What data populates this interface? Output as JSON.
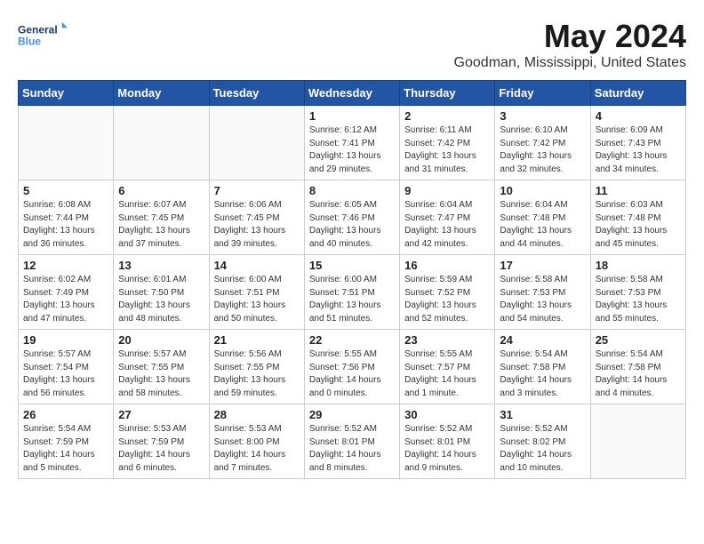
{
  "logo": {
    "line1": "General",
    "line2": "Blue"
  },
  "title": "May 2024",
  "subtitle": "Goodman, Mississippi, United States",
  "headers": [
    "Sunday",
    "Monday",
    "Tuesday",
    "Wednesday",
    "Thursday",
    "Friday",
    "Saturday"
  ],
  "weeks": [
    [
      {
        "day": "",
        "info": ""
      },
      {
        "day": "",
        "info": ""
      },
      {
        "day": "",
        "info": ""
      },
      {
        "day": "1",
        "info": "Sunrise: 6:12 AM\nSunset: 7:41 PM\nDaylight: 13 hours\nand 29 minutes."
      },
      {
        "day": "2",
        "info": "Sunrise: 6:11 AM\nSunset: 7:42 PM\nDaylight: 13 hours\nand 31 minutes."
      },
      {
        "day": "3",
        "info": "Sunrise: 6:10 AM\nSunset: 7:42 PM\nDaylight: 13 hours\nand 32 minutes."
      },
      {
        "day": "4",
        "info": "Sunrise: 6:09 AM\nSunset: 7:43 PM\nDaylight: 13 hours\nand 34 minutes."
      }
    ],
    [
      {
        "day": "5",
        "info": "Sunrise: 6:08 AM\nSunset: 7:44 PM\nDaylight: 13 hours\nand 36 minutes."
      },
      {
        "day": "6",
        "info": "Sunrise: 6:07 AM\nSunset: 7:45 PM\nDaylight: 13 hours\nand 37 minutes."
      },
      {
        "day": "7",
        "info": "Sunrise: 6:06 AM\nSunset: 7:45 PM\nDaylight: 13 hours\nand 39 minutes."
      },
      {
        "day": "8",
        "info": "Sunrise: 6:05 AM\nSunset: 7:46 PM\nDaylight: 13 hours\nand 40 minutes."
      },
      {
        "day": "9",
        "info": "Sunrise: 6:04 AM\nSunset: 7:47 PM\nDaylight: 13 hours\nand 42 minutes."
      },
      {
        "day": "10",
        "info": "Sunrise: 6:04 AM\nSunset: 7:48 PM\nDaylight: 13 hours\nand 44 minutes."
      },
      {
        "day": "11",
        "info": "Sunrise: 6:03 AM\nSunset: 7:48 PM\nDaylight: 13 hours\nand 45 minutes."
      }
    ],
    [
      {
        "day": "12",
        "info": "Sunrise: 6:02 AM\nSunset: 7:49 PM\nDaylight: 13 hours\nand 47 minutes."
      },
      {
        "day": "13",
        "info": "Sunrise: 6:01 AM\nSunset: 7:50 PM\nDaylight: 13 hours\nand 48 minutes."
      },
      {
        "day": "14",
        "info": "Sunrise: 6:00 AM\nSunset: 7:51 PM\nDaylight: 13 hours\nand 50 minutes."
      },
      {
        "day": "15",
        "info": "Sunrise: 6:00 AM\nSunset: 7:51 PM\nDaylight: 13 hours\nand 51 minutes."
      },
      {
        "day": "16",
        "info": "Sunrise: 5:59 AM\nSunset: 7:52 PM\nDaylight: 13 hours\nand 52 minutes."
      },
      {
        "day": "17",
        "info": "Sunrise: 5:58 AM\nSunset: 7:53 PM\nDaylight: 13 hours\nand 54 minutes."
      },
      {
        "day": "18",
        "info": "Sunrise: 5:58 AM\nSunset: 7:53 PM\nDaylight: 13 hours\nand 55 minutes."
      }
    ],
    [
      {
        "day": "19",
        "info": "Sunrise: 5:57 AM\nSunset: 7:54 PM\nDaylight: 13 hours\nand 56 minutes."
      },
      {
        "day": "20",
        "info": "Sunrise: 5:57 AM\nSunset: 7:55 PM\nDaylight: 13 hours\nand 58 minutes."
      },
      {
        "day": "21",
        "info": "Sunrise: 5:56 AM\nSunset: 7:55 PM\nDaylight: 13 hours\nand 59 minutes."
      },
      {
        "day": "22",
        "info": "Sunrise: 5:55 AM\nSunset: 7:56 PM\nDaylight: 14 hours\nand 0 minutes."
      },
      {
        "day": "23",
        "info": "Sunrise: 5:55 AM\nSunset: 7:57 PM\nDaylight: 14 hours\nand 1 minute."
      },
      {
        "day": "24",
        "info": "Sunrise: 5:54 AM\nSunset: 7:58 PM\nDaylight: 14 hours\nand 3 minutes."
      },
      {
        "day": "25",
        "info": "Sunrise: 5:54 AM\nSunset: 7:58 PM\nDaylight: 14 hours\nand 4 minutes."
      }
    ],
    [
      {
        "day": "26",
        "info": "Sunrise: 5:54 AM\nSunset: 7:59 PM\nDaylight: 14 hours\nand 5 minutes."
      },
      {
        "day": "27",
        "info": "Sunrise: 5:53 AM\nSunset: 7:59 PM\nDaylight: 14 hours\nand 6 minutes."
      },
      {
        "day": "28",
        "info": "Sunrise: 5:53 AM\nSunset: 8:00 PM\nDaylight: 14 hours\nand 7 minutes."
      },
      {
        "day": "29",
        "info": "Sunrise: 5:52 AM\nSunset: 8:01 PM\nDaylight: 14 hours\nand 8 minutes."
      },
      {
        "day": "30",
        "info": "Sunrise: 5:52 AM\nSunset: 8:01 PM\nDaylight: 14 hours\nand 9 minutes."
      },
      {
        "day": "31",
        "info": "Sunrise: 5:52 AM\nSunset: 8:02 PM\nDaylight: 14 hours\nand 10 minutes."
      },
      {
        "day": "",
        "info": ""
      }
    ]
  ]
}
